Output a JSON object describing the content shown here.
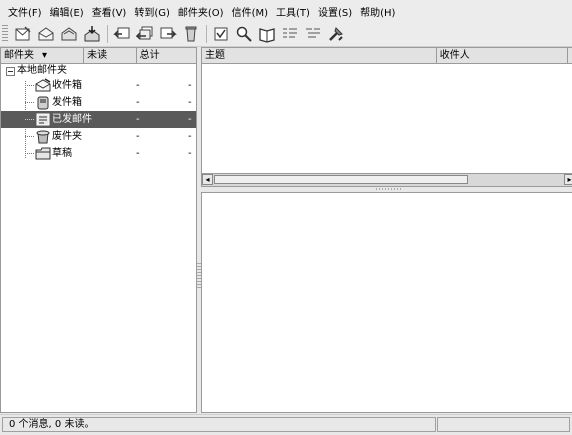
{
  "menubar": {
    "items": [
      "文件(F)",
      "编辑(E)",
      "查看(V)",
      "转到(G)",
      "邮件夹(O)",
      "信件(M)",
      "工具(T)",
      "设置(S)",
      "帮助(H)"
    ]
  },
  "toolbar": {
    "buttons": [
      "new-message-icon",
      "get-mail-icon",
      "send-mail-icon",
      "send-receive-icon",
      "reply-icon",
      "reply-all-icon",
      "forward-icon",
      "delete-icon",
      "mark-icon",
      "search-icon",
      "address-book-icon",
      "thread-expand-icon",
      "thread-collapse-icon",
      "tools-icon"
    ]
  },
  "folder_pane": {
    "columns": [
      "邮件夹",
      "未读",
      "总计"
    ],
    "root": "本地邮件夹",
    "folders": [
      {
        "name": "收件箱",
        "unread": "-",
        "total": "-",
        "icon": "inbox-icon"
      },
      {
        "name": "发件箱",
        "unread": "-",
        "total": "-",
        "icon": "outbox-icon"
      },
      {
        "name": "已发邮件",
        "unread": "-",
        "total": "-",
        "icon": "sent-icon",
        "selected": true
      },
      {
        "name": "废件夹",
        "unread": "-",
        "total": "-",
        "icon": "trash-icon"
      },
      {
        "name": "草稿",
        "unread": "-",
        "total": "-",
        "icon": "drafts-icon"
      }
    ]
  },
  "message_list": {
    "columns": [
      "主题",
      "收件人"
    ]
  },
  "statusbar": {
    "text": "0 个消息, 0 未读。"
  }
}
